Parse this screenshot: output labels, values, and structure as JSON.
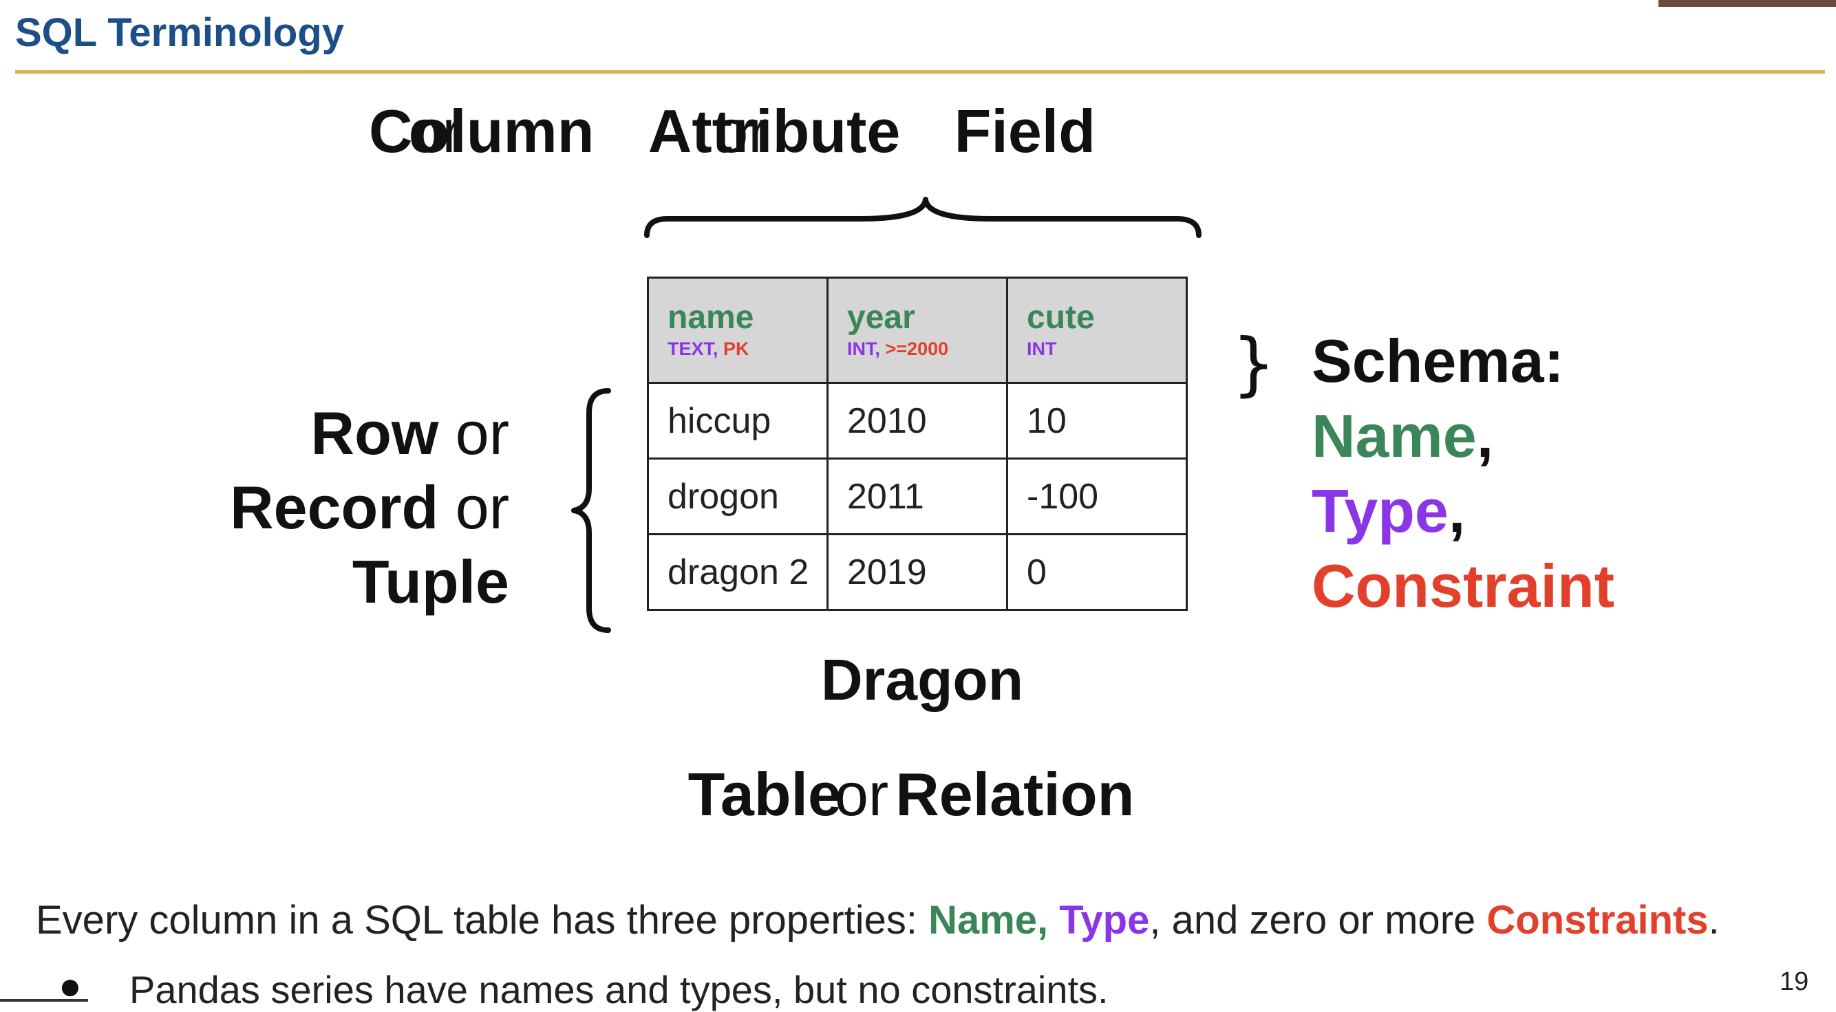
{
  "slide": {
    "title": "SQL Terminology",
    "page_number": "19"
  },
  "column_heading": {
    "a": "Column",
    "or1": " or ",
    "b": "Attribute",
    "or2": " or ",
    "c": "Field"
  },
  "row_heading": {
    "a": "Row",
    "or1": " or",
    "b": "Record",
    "or2": " or",
    "c": "Tuple"
  },
  "table": {
    "name": "Dragon",
    "columns": [
      {
        "name": "name",
        "type": "TEXT",
        "constraint": "PK"
      },
      {
        "name": "year",
        "type": "INT",
        "constraint": ">=2000"
      },
      {
        "name": "cute",
        "type": "INT",
        "constraint": ""
      }
    ],
    "rows": [
      [
        "hiccup",
        "2010",
        "10"
      ],
      [
        "drogon",
        "2011",
        "-100"
      ],
      [
        "dragon 2",
        "2019",
        "0"
      ]
    ]
  },
  "relation_heading": {
    "a": "Table",
    "or1": " or ",
    "b": "Relation"
  },
  "schema": {
    "brace": "}",
    "title": "Schema:",
    "name": "Name",
    "type": "Type",
    "constraint": "Constraint",
    "comma": ","
  },
  "body": {
    "line_start": "Every column in a SQL table has three properties: ",
    "name": "Name,",
    "space": " ",
    "type": "Type",
    "line_mid": ", and zero or more ",
    "constraints": "Constraints",
    "line_end": ".",
    "bullet_symbol": "●",
    "bullet_text": "Pandas series have names and types, but no constraints."
  },
  "colors": {
    "title": "#1c4e87",
    "rule": "#d8b457",
    "name_green": "#3a8659",
    "type_purple": "#8a35e6",
    "constraint_red": "#e3402c",
    "header_fill": "#d6d6d6"
  }
}
